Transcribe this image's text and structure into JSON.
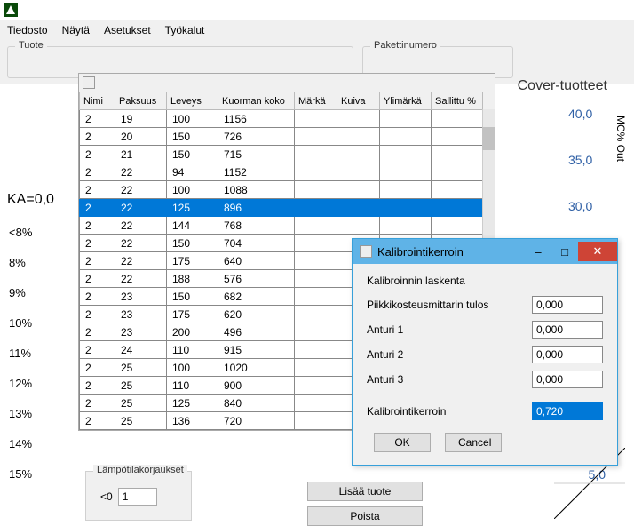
{
  "menubar": {
    "file": "Tiedosto",
    "view": "Näytä",
    "settings": "Asetukset",
    "tools": "Työkalut"
  },
  "top": {
    "product_label": "Tuote",
    "package_label": "Pakettinumero"
  },
  "cover_title": "Cover-tuotteet",
  "ka_label": "KA=0,0",
  "left_axis": [
    "<8%",
    "8%",
    "9%",
    "10%",
    "11%",
    "12%",
    "13%",
    "14%",
    "15%"
  ],
  "right_axis": {
    "title": "MC% Out",
    "ticks": [
      "40,0",
      "35,0",
      "30,0"
    ],
    "bottom_tick": "5,0"
  },
  "grid": {
    "headers": [
      "Nimi",
      "Paksuus",
      "Leveys",
      "Kuorman koko",
      "Märkä",
      "Kuiva",
      "Ylimärkä",
      "Sallittu %"
    ],
    "selected_index": 5,
    "rows": [
      [
        "2",
        "19",
        "100",
        "1156",
        "",
        "",
        "",
        ""
      ],
      [
        "2",
        "20",
        "150",
        "726",
        "",
        "",
        "",
        ""
      ],
      [
        "2",
        "21",
        "150",
        "715",
        "",
        "",
        "",
        ""
      ],
      [
        "2",
        "22",
        "94",
        "1152",
        "",
        "",
        "",
        ""
      ],
      [
        "2",
        "22",
        "100",
        "1088",
        "",
        "",
        "",
        ""
      ],
      [
        "2",
        "22",
        "125",
        "896",
        "",
        "",
        "",
        ""
      ],
      [
        "2",
        "22",
        "144",
        "768",
        "",
        "",
        "",
        ""
      ],
      [
        "2",
        "22",
        "150",
        "704",
        "",
        "",
        "",
        ""
      ],
      [
        "2",
        "22",
        "175",
        "640",
        "",
        "",
        "",
        ""
      ],
      [
        "2",
        "22",
        "188",
        "576",
        "",
        "",
        "",
        ""
      ],
      [
        "2",
        "23",
        "150",
        "682",
        "",
        "",
        "",
        ""
      ],
      [
        "2",
        "23",
        "175",
        "620",
        "",
        "",
        "",
        ""
      ],
      [
        "2",
        "23",
        "200",
        "496",
        "",
        "",
        "",
        ""
      ],
      [
        "2",
        "24",
        "110",
        "915",
        "",
        "",
        "",
        ""
      ],
      [
        "2",
        "25",
        "100",
        "1020",
        "",
        "",
        "",
        ""
      ],
      [
        "2",
        "25",
        "110",
        "900",
        "",
        "",
        "",
        ""
      ],
      [
        "2",
        "25",
        "125",
        "840",
        "",
        "",
        "",
        ""
      ],
      [
        "2",
        "25",
        "136",
        "720",
        "",
        "",
        "",
        ""
      ]
    ]
  },
  "bottom": {
    "temp_label": "Lämpötilakorjaukset",
    "lt0_label": "<0",
    "lt0_value": "1",
    "add_button": "Lisää tuote",
    "delete_button": "Poista"
  },
  "dialog": {
    "title": "Kalibrointikerroin",
    "section": "Kalibroinnin laskenta",
    "spike_label": "Piikkikosteusmittarin tulos",
    "spike_value": "0,000",
    "anturi1_label": "Anturi 1",
    "anturi1_value": "0,000",
    "anturi2_label": "Anturi 2",
    "anturi2_value": "0,000",
    "anturi3_label": "Anturi 3",
    "anturi3_value": "0,000",
    "factor_label": "Kalibrointikerroin",
    "factor_value": "0,720",
    "ok": "OK",
    "cancel": "Cancel"
  }
}
